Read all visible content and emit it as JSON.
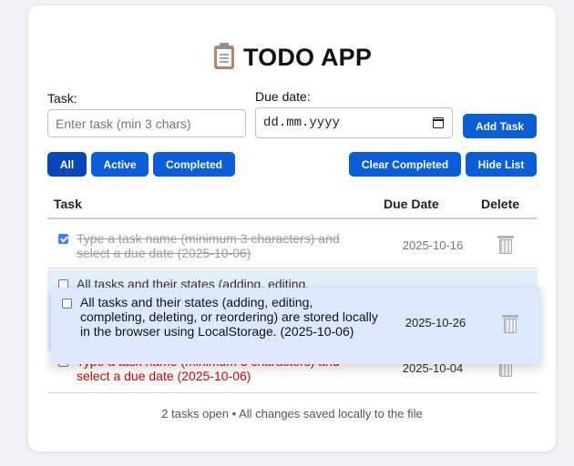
{
  "app": {
    "title": "TODO APP",
    "icon": "clipboard-icon"
  },
  "form": {
    "task_label": "Task:",
    "task_placeholder": "Enter task (min 3 chars)",
    "task_value": "",
    "due_label": "Due date:",
    "due_value": "dd.mm.yyyy",
    "add_button": "Add Task"
  },
  "filters": {
    "all": "All",
    "active": "Active",
    "completed": "Completed",
    "selected": "All"
  },
  "actions": {
    "clear_completed": "Clear Completed",
    "hide_list": "Hide List"
  },
  "table": {
    "headers": {
      "task": "Task",
      "due": "Due Date",
      "delete": "Delete"
    },
    "rows": [
      {
        "text": "Type a task name (minimum 3 characters) and select a due date (2025-10-06)",
        "due": "2025-10-16",
        "done": true,
        "overdue": false
      },
      {
        "text": "All tasks and their states (adding, editing, completing, deleting, or reordering) are stored locally in the browser using LocalStorage. (2025-10-06)",
        "due": "2025-10-26",
        "done": false,
        "overdue": false,
        "dragging": true
      },
      {
        "text": "Type a task name (minimum 3 characters) and select a due date (2025-10-06)",
        "due": "2025-10-04",
        "done": false,
        "overdue": true
      }
    ],
    "ghost_row_line1": "All tasks and their states (adding, editing,",
    "ghost_row_partial": "ored",
    "ghost_date_partial": "2025-10-26",
    "ghost_row3_line1": "Type a task name (minimum 3 characters) and"
  },
  "footer": {
    "status": "2 tasks open • All changes saved locally to the file"
  },
  "colors": {
    "primary": "#0b5ed7",
    "overdue": "#d20000",
    "drag_highlight": "#dbe8fd"
  }
}
